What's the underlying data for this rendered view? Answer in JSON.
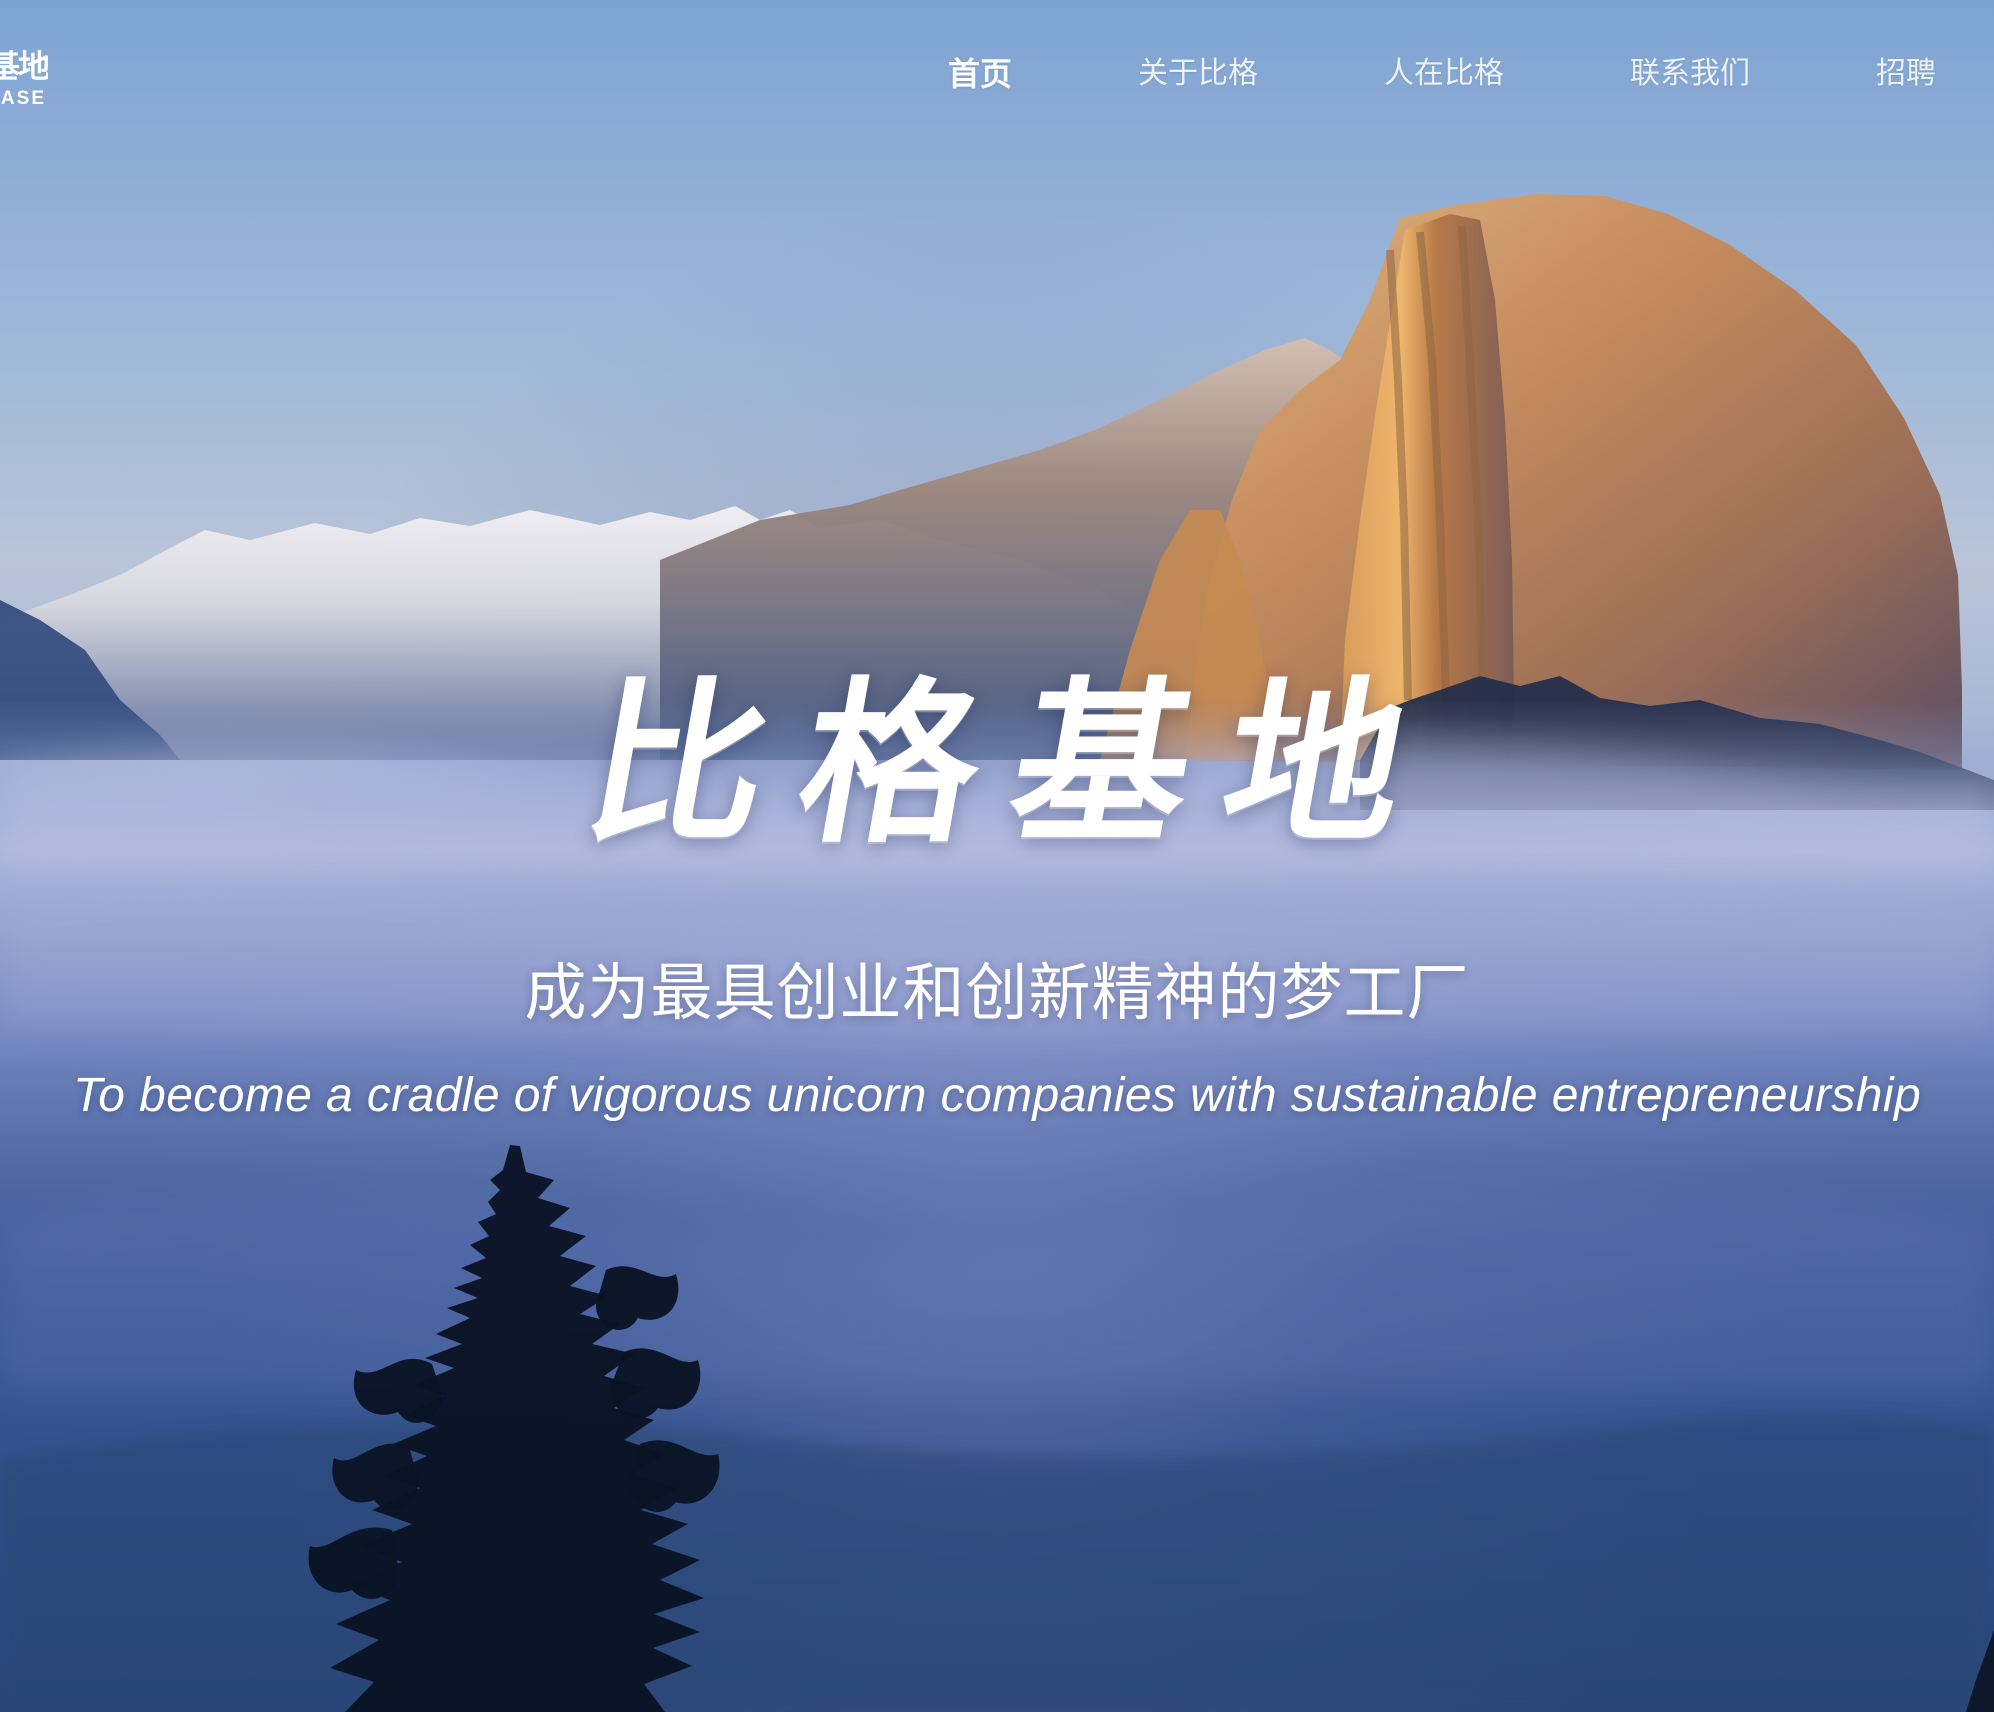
{
  "nav": {
    "logo": {
      "cn": "基地",
      "en": "BASE"
    },
    "items": [
      {
        "label": "首页",
        "active": true
      },
      {
        "label": "关于比格",
        "active": false
      },
      {
        "label": "人在比格",
        "active": false
      },
      {
        "label": "联系我们",
        "active": false
      },
      {
        "label": "招聘",
        "active": false
      }
    ]
  },
  "hero": {
    "title": "比格基地",
    "subtitle_cn": "成为最具创业和创新精神的梦工厂",
    "subtitle_en": "To become a cradle of vigorous unicorn companies with sustainable entrepreneurship"
  },
  "colors": {
    "sky_top": "#7ea3d3",
    "fog": "#8a9ccc",
    "deep_blue": "#284579",
    "rock_highlight": "#c9945f",
    "text": "#ffffff"
  }
}
